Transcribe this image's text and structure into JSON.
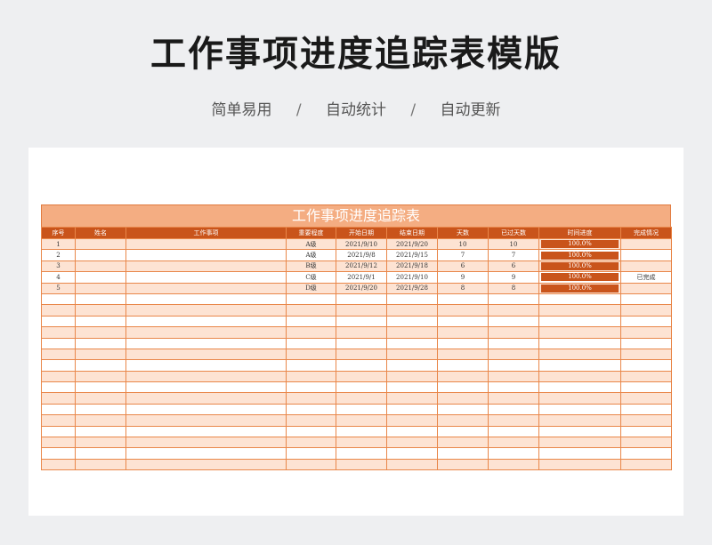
{
  "header": {
    "title": "工作事项进度追踪表模版",
    "tags": [
      "简单易用",
      "自动统计",
      "自动更新"
    ],
    "separator": "/"
  },
  "sheet": {
    "title": "工作事项进度追踪表",
    "columns": [
      "序号",
      "姓名",
      "工作事项",
      "重要程度",
      "开始日期",
      "结束日期",
      "天数",
      "已过天数",
      "时间进度",
      "完成情况"
    ],
    "rows": [
      {
        "no": "1",
        "name": "",
        "task": "",
        "level": "A级",
        "start": "2021/9/10",
        "end": "2021/9/20",
        "days": "10",
        "passed": "10",
        "progress": "100.0%",
        "status": ""
      },
      {
        "no": "2",
        "name": "",
        "task": "",
        "level": "A级",
        "start": "2021/9/8",
        "end": "2021/9/15",
        "days": "7",
        "passed": "7",
        "progress": "100.0%",
        "status": ""
      },
      {
        "no": "3",
        "name": "",
        "task": "",
        "level": "B级",
        "start": "2021/9/12",
        "end": "2021/9/18",
        "days": "6",
        "passed": "6",
        "progress": "100.0%",
        "status": ""
      },
      {
        "no": "4",
        "name": "",
        "task": "",
        "level": "C级",
        "start": "2021/9/1",
        "end": "2021/9/10",
        "days": "9",
        "passed": "9",
        "progress": "100.0%",
        "status": "已完成"
      },
      {
        "no": "5",
        "name": "",
        "task": "",
        "level": "D级",
        "start": "2021/9/20",
        "end": "2021/9/28",
        "days": "8",
        "passed": "8",
        "progress": "100.0%",
        "status": ""
      }
    ],
    "empty_rows": 16
  },
  "colors": {
    "header_bg": "#c9541b",
    "title_bg": "#f4ad82",
    "band": "#fde3d3",
    "border": "#e9874a"
  }
}
